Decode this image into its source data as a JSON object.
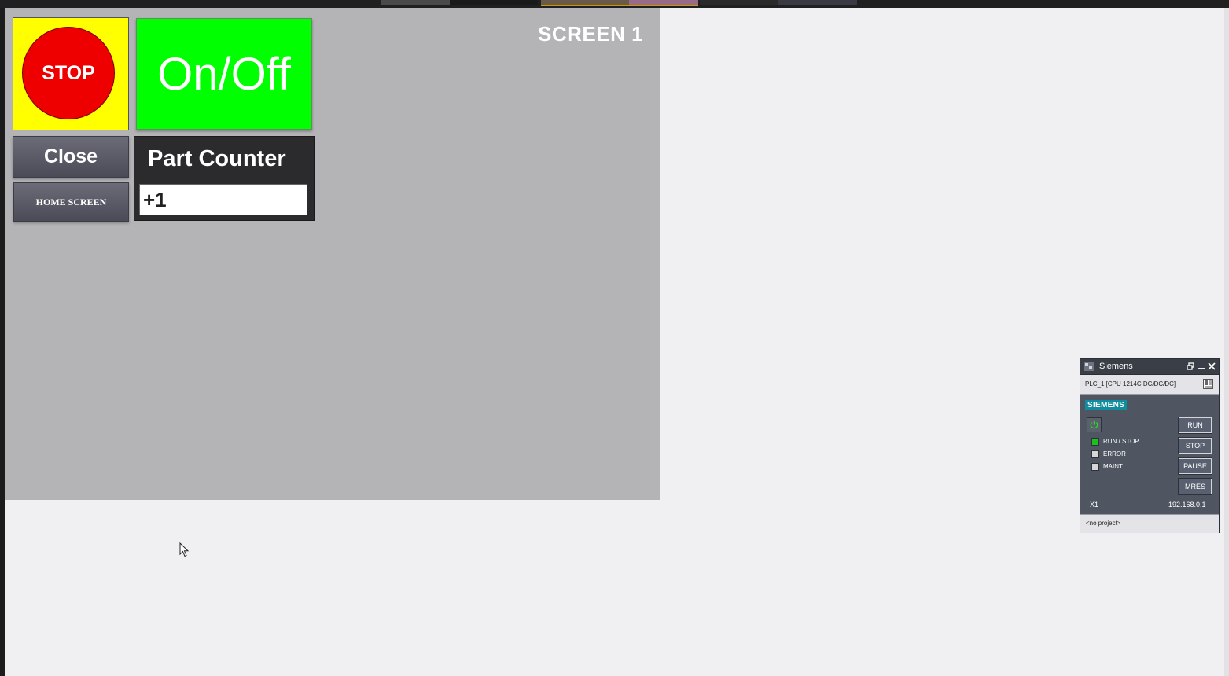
{
  "hmi": {
    "screen_title": "SCREEN 1",
    "stop_label": "STOP",
    "onoff_label": "On/Off",
    "close_label": "Close",
    "home_label": "HOME SCREEN",
    "counter_title": "Part Counter",
    "counter_value": "+1",
    "colors": {
      "stop_bg": "#ffff00",
      "stop_circle": "#ee0000",
      "onoff_bg": "#00ff00",
      "panel_bg": "#b4b4b6"
    }
  },
  "plcsim": {
    "title": "Siemens",
    "device": "PLC_1 [CPU 1214C DC/DC/DC]",
    "brand": "SIEMENS",
    "leds": [
      {
        "label": "RUN / STOP",
        "color": "#19c21e"
      },
      {
        "label": "ERROR",
        "color": "#d6d6d6"
      },
      {
        "label": "MAINT",
        "color": "#d6d6d6"
      }
    ],
    "buttons": {
      "run": "RUN",
      "stop": "STOP",
      "pause": "PAUSE",
      "mres": "MRES"
    },
    "interface": "X1",
    "ip": "192.168.0.1",
    "project": "<no project>"
  }
}
